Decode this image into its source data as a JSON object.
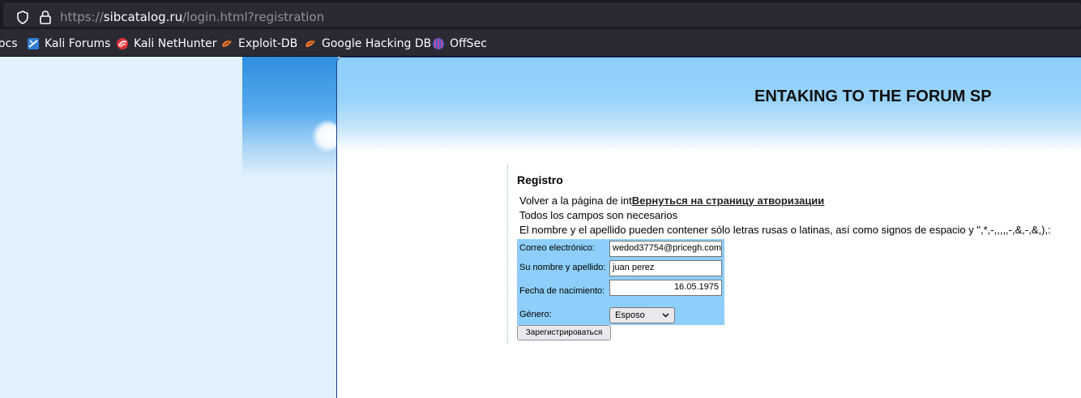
{
  "browser": {
    "url_prefix": "https://",
    "url_host": "sibcatalog.ru",
    "url_path": "/login.html?registration",
    "bookmarks": [
      {
        "label": "ocs",
        "icon": "docs-icon"
      },
      {
        "label": "Kali Forums",
        "icon": "kali-forums-icon"
      },
      {
        "label": "Kali NetHunter",
        "icon": "kali-nethunter-icon"
      },
      {
        "label": "Exploit-DB",
        "icon": "exploit-db-icon"
      },
      {
        "label": "Google Hacking DB",
        "icon": "ghdb-icon"
      },
      {
        "label": "OffSec",
        "icon": "offsec-icon"
      }
    ]
  },
  "header": {
    "title": "ENTAKING TO THE FORUM SP"
  },
  "registration": {
    "heading": "Registro",
    "back_prefix": "Volver a la página de int",
    "back_link": "Вернуться на страницу атворизации",
    "all_required": "Todos los campos son necesarios",
    "name_rule": "El nombre y el apellido pueden contener sólo letras rusas o latinas, así como signos de espacio y \",*,-,,,,,-,&,-,&,),:",
    "fields": {
      "email_label": "Correo electrónico:",
      "email_value": "wedod37754@pricegh.com",
      "name_label": "Su nombre y apellido:",
      "name_value": "juan perez",
      "birth_label": "Fecha de nacimiento:",
      "birth_value": "16.05.1975",
      "gender_label": "Género:",
      "gender_value": "Esposo"
    },
    "submit_label": "Зарегистрироваться"
  },
  "colors": {
    "form_background": "#8dcffa",
    "banner_top": "#8dcffa",
    "page_background": "#e1f1fb"
  }
}
